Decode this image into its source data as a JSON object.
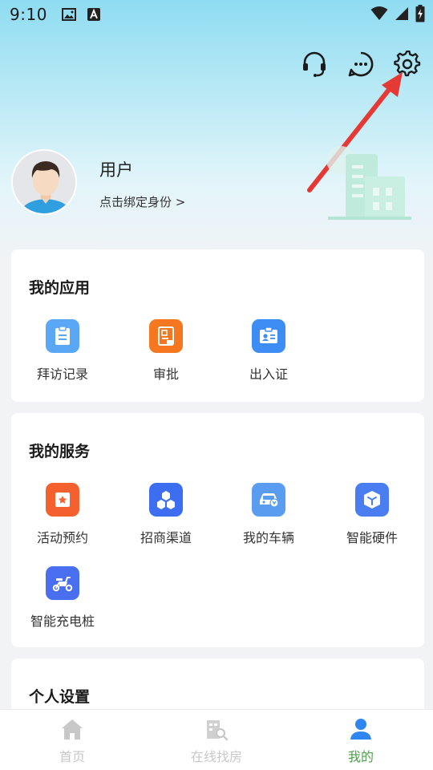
{
  "status_bar": {
    "time": "9:10"
  },
  "header": {
    "user_name": "用户",
    "bind_identity_link": "点击绑定身份 >"
  },
  "my_apps": {
    "title": "我的应用",
    "items": [
      {
        "label": "拜访记录",
        "icon": "clipboard-icon",
        "color": "#5aa8f5"
      },
      {
        "label": "审批",
        "icon": "approval-doc-icon",
        "color": "#f5771f"
      },
      {
        "label": "出入证",
        "icon": "id-card-icon",
        "color": "#3d8df5"
      }
    ]
  },
  "my_services": {
    "title": "我的服务",
    "items": [
      {
        "label": "活动预约",
        "icon": "star-ticket-icon",
        "color": "#f5612e"
      },
      {
        "label": "招商渠道",
        "icon": "hexagons-icon",
        "color": "#3d6ef0"
      },
      {
        "label": "我的车辆",
        "icon": "car-icon",
        "color": "#5a9df0"
      },
      {
        "label": "智能硬件",
        "icon": "cube-icon",
        "color": "#4a7ef0"
      },
      {
        "label": "智能充电桩",
        "icon": "scooter-icon",
        "color": "#4a6ef0"
      }
    ]
  },
  "personal_settings": {
    "title": "个人设置"
  },
  "tab_bar": {
    "tabs": [
      {
        "label": "首页",
        "icon": "home-icon"
      },
      {
        "label": "在线找房",
        "icon": "building-search-icon"
      },
      {
        "label": "我的",
        "icon": "person-icon",
        "active": true
      }
    ]
  },
  "colors": {
    "accent_green": "#4fa04a",
    "arrow_red": "#e53935",
    "header_gradient_top": "#8fdcf2"
  }
}
